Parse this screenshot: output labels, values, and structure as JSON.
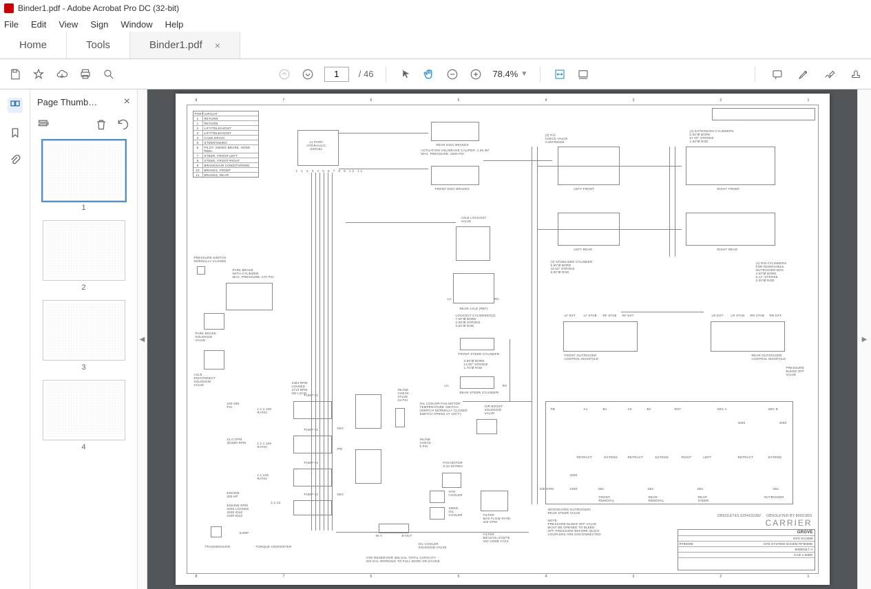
{
  "window": {
    "title": "Binder1.pdf - Adobe Acrobat Pro DC (32-bit)"
  },
  "menubar": [
    "File",
    "Edit",
    "View",
    "Sign",
    "Window",
    "Help"
  ],
  "tabs": {
    "home": "Home",
    "tools": "Tools",
    "doc": "Binder1.pdf"
  },
  "toolbar": {
    "page_current": "1",
    "page_total": "/ 46",
    "zoom": "78.4%"
  },
  "sidebar": {
    "title": "Page Thumb…"
  },
  "thumbnails": [
    {
      "label": "1"
    },
    {
      "label": "2"
    },
    {
      "label": "3"
    },
    {
      "label": "4"
    }
  ],
  "schematic": {
    "ruler": [
      "8",
      "7",
      "6",
      "5",
      "4",
      "3",
      "2",
      "1"
    ],
    "port_table": {
      "header": [
        "PORT",
        "CIRCUIT"
      ],
      "rows": [
        [
          "1",
          "RETURN"
        ],
        [
          "1",
          "RETURN"
        ],
        [
          "2",
          "LIFT/TELE/HOIST"
        ],
        [
          "3",
          "LIFT/TELE/HOIST"
        ],
        [
          "4",
          "CASE DRAIN"
        ],
        [
          "5",
          "STEER/SWING"
        ],
        [
          "6",
          "PILOT, SWING BRAKE, HOSE REEL"
        ],
        [
          "7",
          "STEER, FRONT-LEFT"
        ],
        [
          "8",
          "STEER, FRONT-RIGHT"
        ],
        [
          "9",
          "BRAKES/AIR CONDITIONING"
        ],
        [
          "10",
          "BRAKES, FRONT"
        ],
        [
          "11",
          "BRAKES, REAR"
        ]
      ]
    },
    "labels": {
      "swivel": "11 PORT\nHYDRAULIC\nSWIVEL",
      "rear_disc": "REAR DISC BRAKES",
      "actuation": "ACTUATION VOL/BRAKE CALIPER: 1.60 IN³\nMAX. PRESSURE: 2500 PSI",
      "front_disc": "FRONT DISC BRAKES",
      "check_valve": "(4) P.O.\nCHECK VALVE\nCARTRIDGE",
      "left_front": "LEFT FRONT",
      "right_front": "RIGHT FRONT",
      "left_rear": "LEFT REAR",
      "right_rear": "RIGHT REAR",
      "ext_cyl": "(4) EXTENSION CYLINDERS\n2.50\"Ø BORE\n57.00\" STROKE\n1.50\"Ø ROD",
      "pressure_sw": "PRESSURE SWITCH\nNORMALLY CLOSED",
      "park_brake": "PARK BRAKE\nWITH CYLINDER\nMAX. PRESSURE: 270 PSI",
      "park_brake_sol": "PARK BRAKE\nSOLENOID\nVALVE",
      "axle_disc": "AXLE\nDISCONNECT\nSOLENOID\nVALVE",
      "stabilizer": "(4) STABILIZER CYLINDER\n5.50\"Ø BORE\n16.63\" STROKE\n5.00\"Ø ROD",
      "pin_cyl": "(4) PIN CYLINDERS\nFOR REMOVABLE\nOUTRIGGER BOX\n4.00\"Ø BORE\n6.12\" STROKE\n2.00\"Ø ROD",
      "axle_lockout": "AXLE LOCKOUT\nVALVE",
      "rear_axle": "REAR AXLE (REF)",
      "lockout_cyl": "LOCKOUT CYLINDERS(2)\n7.00\"Ø BORE\n2.38\"Ø STROKE\n3.62\"Ø ROD",
      "front_outrigger": "FRONT OUTRIGGER\nCONTROL MANIFOLD",
      "rear_outrigger": "REAR OUTRIGGER\nCONTROL MANIFOLD",
      "front_steer": "FRONT STEER CYLINDER",
      "steer_spec": "3.50\"Ø BORE\n14.00\" STROKE\n1.75\"Ø ROD",
      "rear_steer": "REAR STEER CYLINDER",
      "pump1": "PUMP #1",
      "pump1_spec": "2484 RPM\nLOADED\n2710 RPM\nNO LOAD",
      "pump2": "PUMP #2",
      "pump3": "PUMP #3",
      "pump4": "PUMP #4",
      "psi": "240-280\nPSI",
      "gpm": "21.0 GPM\n@2000 RPM",
      "ratio1": "1.1:1.129\nRATIO",
      "ratio2": "1:1.129\nRATIO",
      "ratio3": "1:1.13",
      "engine": "ENGINE\n300 HP",
      "engine_rpm": "ENGINE RPM\n3200 LOADED\n3400 IDLE\n2200 IDLE",
      "sump": "SUMP",
      "transmission": "TRANSMISSION",
      "torque": "TORQUE CONVERTER",
      "inline_check": "INLINE\nCHECK\nVALVE\n15 PSI",
      "oil_cooler_sw": "OIL COOLER FAN MOTOR\nTEMPERATURE SWITCH\n(SWITCH NORMALLY CLOSED\nSWITCH OPENS AT 120°F)",
      "or_boost": "O/R BOOST\nSOLENOID\nVALVE",
      "pri": "PRI",
      "sec": "SEC",
      "fan_motor": "FAN MOTOR\n0.43 IN³/REV",
      "hyd_cooler": "HYD\nCOOLER",
      "xmsn_cooler": "XMSN\nOIL\nCOOLER",
      "filter": "FILTER\nMAX FLOW RATE:\n315 GPM",
      "integrated": "INTEGRATED OUTRIGGER/\nREAR STEER VALVE",
      "note": "NOTE:\nPRESSURE BLEED OFF VALVE\nMUST BE OPENED TO BLEED\nOFF PRESSURE BEFORE QUICK\nCOUPLERS ARE DISCONNECTED",
      "filter2": "FILTER\nB5/12/16=2/20/75\nISO CODE 17/14",
      "in_a": "IN-A",
      "b_out": "B-OUT",
      "oil_cooler_sol": "OIL COOLER\nSOLENOID VALVE",
      "reservoir": "HYD RESERVOIR 365 GAL TOTAL CAPACITY\n324 GAL WORKING TO FULL MARK ON GAUGE",
      "pb": "PB",
      "a1": "A1",
      "b1": "B1",
      "a2": "A2",
      "b2": "B2",
      "rst": "RST",
      "inlet_check": "INLINE\nCHECK\n5 PSI",
      "seca": "SEC A",
      "secb": "SEC B",
      "relief": "4000",
      "retract": "RETRACT",
      "extend": "EXTEND",
      "right": "RIGHT",
      "left": "LEFT",
      "front_rem": "FRONT\nREMOVAL",
      "rear_rem": "REAR\nREMOVAL",
      "rear_st": "REAR\nSTEER",
      "outrigger": "OUTRIGGER",
      "val062": ".062",
      "val2000": "2000",
      "val1500": "1500",
      "val335": "335 GPM",
      "lf_ext": "LF EXT",
      "lf_stab": "LF STAB",
      "rf_stab": "RF STAB",
      "rf_ext": "RF EXT",
      "lr_ext": "LR EXT",
      "lr_stab": "LR STAB",
      "rr_stab": "RR STAB",
      "rr_ext": "RR EXT",
      "lh": "LH",
      "rh": "RH",
      "pressure_bleed": "PRESSURE\nBLEED OFF\nVALVE",
      "obsoletes": "OBSOLETES 6294102382",
      "obsoleted_by": "OBSOLETED BY 80001855",
      "carrier": "CARRIER"
    },
    "titleblock": {
      "grove": "GROVE",
      "title": "HYD SCHEM",
      "subtitle": "HYD SYSTEM SCHEM RT9000E",
      "model": "RT9000E",
      "drawing": "80000117",
      "rev": "A",
      "cad": "CAD-1 DWG"
    }
  }
}
